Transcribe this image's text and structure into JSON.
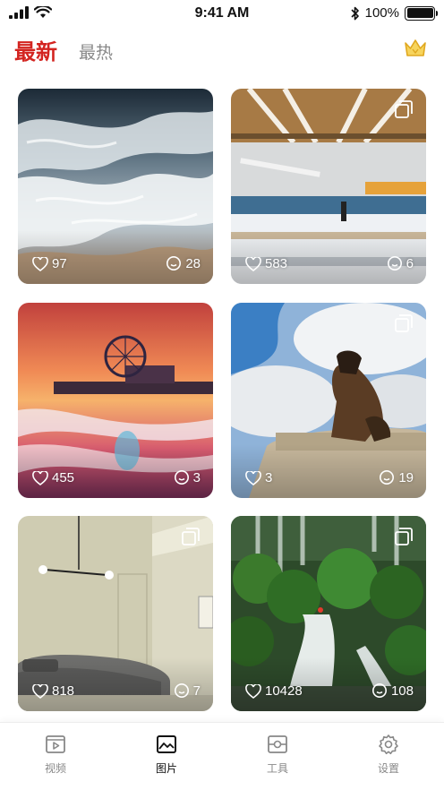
{
  "status_bar": {
    "time": "9:41 AM",
    "battery": "100%",
    "battery_level": 1.0
  },
  "header": {
    "tab_latest": "最新",
    "tab_hot": "最热",
    "vip_icon": "crown-icon",
    "accent": "#d32420"
  },
  "cards": [
    {
      "likes": "97",
      "comments": "28",
      "multi": false,
      "scene": "ocean-waves"
    },
    {
      "likes": "583",
      "comments": "6",
      "multi": true,
      "scene": "warehouse"
    },
    {
      "likes": "455",
      "comments": "3",
      "multi": false,
      "scene": "pier-sunset"
    },
    {
      "likes": "3",
      "comments": "19",
      "multi": true,
      "scene": "dog-on-rock"
    },
    {
      "likes": "818",
      "comments": "7",
      "multi": true,
      "scene": "bedroom"
    },
    {
      "likes": "10428",
      "comments": "108",
      "multi": true,
      "scene": "waterfall"
    }
  ],
  "tabbar": {
    "tabs": [
      {
        "label": "视频",
        "icon": "video-icon",
        "active": false
      },
      {
        "label": "图片",
        "icon": "image-icon",
        "active": true
      },
      {
        "label": "工具",
        "icon": "tool-icon",
        "active": false
      },
      {
        "label": "设置",
        "icon": "settings-icon",
        "active": false
      }
    ]
  }
}
